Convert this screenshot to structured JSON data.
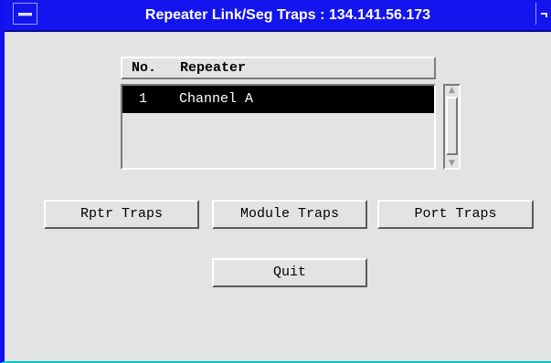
{
  "window": {
    "title": "Repeater Link/Seg Traps : 134.141.56.173"
  },
  "list": {
    "headers": {
      "no": "No.",
      "repeater": "Repeater"
    },
    "rows": [
      {
        "no": "1",
        "repeater": "Channel A",
        "selected": true
      }
    ]
  },
  "buttons": {
    "rptr_traps": "Rptr Traps",
    "module_traps": "Module Traps",
    "port_traps": "Port Traps",
    "quit": "Quit"
  },
  "colors": {
    "titlebar": "#1414ee",
    "background": "#e3e3e3",
    "selection": "#000000"
  }
}
